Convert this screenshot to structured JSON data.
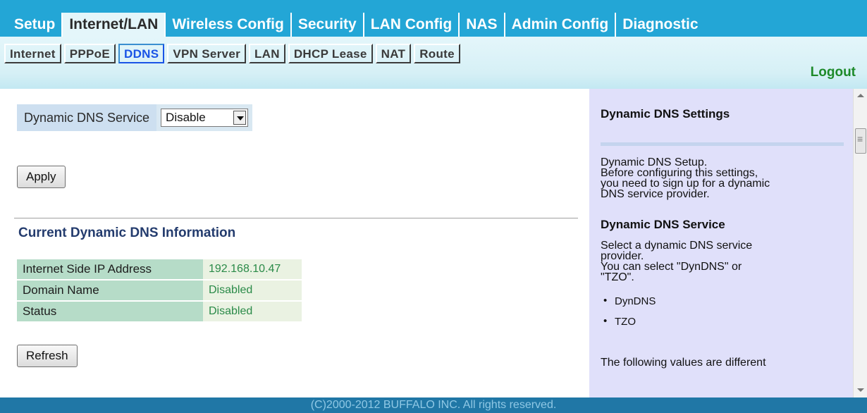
{
  "nav": {
    "tabs": [
      {
        "label": "Setup"
      },
      {
        "label": "Internet/LAN"
      },
      {
        "label": "Wireless Config"
      },
      {
        "label": "Security"
      },
      {
        "label": "LAN Config"
      },
      {
        "label": "NAS"
      },
      {
        "label": "Admin Config"
      },
      {
        "label": "Diagnostic"
      }
    ],
    "active": "Internet/LAN"
  },
  "subnav": {
    "items": [
      {
        "label": "Internet"
      },
      {
        "label": "PPPoE"
      },
      {
        "label": "DDNS"
      },
      {
        "label": "VPN Server"
      },
      {
        "label": "LAN"
      },
      {
        "label": "DHCP Lease"
      },
      {
        "label": "NAT"
      },
      {
        "label": "Route"
      }
    ],
    "active": "DDNS",
    "logout": "Logout"
  },
  "ddns": {
    "label": "Dynamic DNS Service",
    "selected": "Disable",
    "apply": "Apply"
  },
  "current": {
    "title": "Current Dynamic DNS Information",
    "rows": [
      {
        "key": "Internet Side IP Address",
        "value": "192.168.10.47"
      },
      {
        "key": "Domain Name",
        "value": "Disabled"
      },
      {
        "key": "Status",
        "value": "Disabled"
      }
    ],
    "refresh": "Refresh"
  },
  "help": {
    "title": "Dynamic DNS Settings",
    "intro_lines": [
      "Dynamic DNS Setup.",
      "Before configuring this settings,",
      "you need to sign up for a dynamic",
      "DNS service provider."
    ],
    "service_title": "Dynamic DNS Service",
    "service_lines": [
      "Select a dynamic DNS service",
      "provider.",
      "You can select \"DynDNS\" or",
      "\"TZO\"."
    ],
    "options": [
      "DynDNS",
      "TZO"
    ],
    "trailing": "The following values are different"
  },
  "footer": "(C)2000-2012 BUFFALO INC. All rights reserved.",
  "colors": {
    "nav_bg": "#23a6d6",
    "footer_bg": "#2077a6",
    "help_bg": "#e0e0fa",
    "logout": "#1d8a2a"
  }
}
